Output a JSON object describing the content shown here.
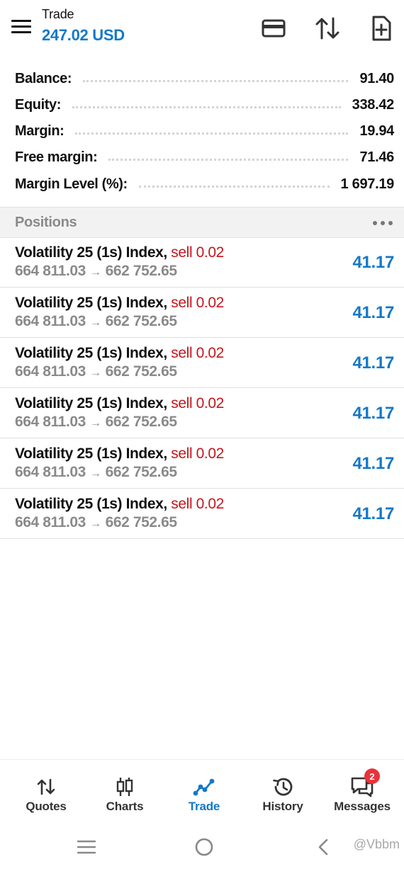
{
  "colors": {
    "accent": "#1478c8",
    "sell": "#c4161c",
    "muted": "#8a8a8a",
    "badge": "#e8323c"
  },
  "header": {
    "title": "Trade",
    "subtitle": "247.02 USD",
    "icons": [
      "menu-icon",
      "card-icon",
      "sort-arrows-icon",
      "new-order-icon"
    ]
  },
  "summary": [
    {
      "label": "Balance:",
      "value": "91.40"
    },
    {
      "label": "Equity:",
      "value": "338.42"
    },
    {
      "label": "Margin:",
      "value": "19.94"
    },
    {
      "label": "Free margin:",
      "value": "71.46"
    },
    {
      "label": "Margin Level (%):",
      "value": "1 697.19"
    }
  ],
  "positions": {
    "title": "Positions",
    "items": [
      {
        "symbol": "Volatility 25 (1s) Index,",
        "side": "sell 0.02",
        "open_price": "664 811.03",
        "arrow": "→",
        "current_price": "662 752.65",
        "profit": "41.17"
      },
      {
        "symbol": "Volatility 25 (1s) Index,",
        "side": "sell 0.02",
        "open_price": "664 811.03",
        "arrow": "→",
        "current_price": "662 752.65",
        "profit": "41.17"
      },
      {
        "symbol": "Volatility 25 (1s) Index,",
        "side": "sell 0.02",
        "open_price": "664 811.03",
        "arrow": "→",
        "current_price": "662 752.65",
        "profit": "41.17"
      },
      {
        "symbol": "Volatility 25 (1s) Index,",
        "side": "sell 0.02",
        "open_price": "664 811.03",
        "arrow": "→",
        "current_price": "662 752.65",
        "profit": "41.17"
      },
      {
        "symbol": "Volatility 25 (1s) Index,",
        "side": "sell 0.02",
        "open_price": "664 811.03",
        "arrow": "→",
        "current_price": "662 752.65",
        "profit": "41.17"
      },
      {
        "symbol": "Volatility 25 (1s) Index,",
        "side": "sell 0.02",
        "open_price": "664 811.03",
        "arrow": "→",
        "current_price": "662 752.65",
        "profit": "41.17"
      }
    ]
  },
  "bottom_nav": {
    "items": [
      {
        "label": "Quotes",
        "icon": "quotes-icon",
        "active": false
      },
      {
        "label": "Charts",
        "icon": "candlestick-icon",
        "active": false
      },
      {
        "label": "Trade",
        "icon": "trade-line-icon",
        "active": true
      },
      {
        "label": "History",
        "icon": "history-icon",
        "active": false
      },
      {
        "label": "Messages",
        "icon": "messages-icon",
        "active": false,
        "badge": "2"
      }
    ]
  },
  "system_nav": {
    "icons": [
      "recents-icon",
      "home-icon",
      "back-icon"
    ],
    "watermark": "@Vbbm"
  }
}
